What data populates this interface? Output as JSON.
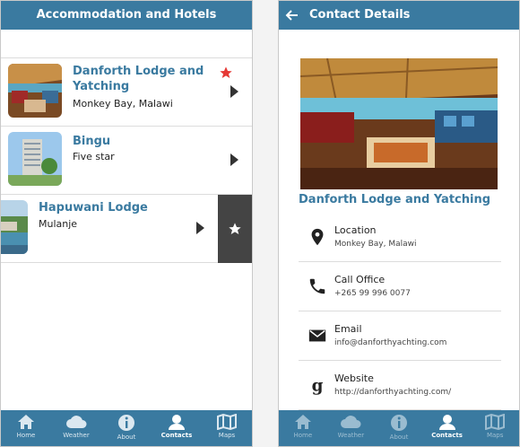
{
  "list_screen": {
    "title": "Accommodation and Hotels",
    "items": [
      {
        "title": "Danforth Lodge and Yatching",
        "subtitle": "Monkey Bay, Malawi",
        "favorite": true
      },
      {
        "title": "Bingu",
        "subtitle": "Five star",
        "favorite": false
      },
      {
        "title": "Hapuwani Lodge",
        "subtitle": "Mulanje",
        "favorite": false
      }
    ]
  },
  "detail_screen": {
    "title": "Contact Details",
    "hotel_name": "Danforth Lodge and Yatching",
    "contacts": [
      {
        "label": "Location",
        "value": "Monkey Bay, Malawi",
        "icon": "location-pin-icon"
      },
      {
        "label": "Call Office",
        "value": "+265 99 996 0077",
        "icon": "phone-icon"
      },
      {
        "label": "Email",
        "value": "info@danforthyachting.com",
        "icon": "email-icon"
      },
      {
        "label": "Website",
        "value": "http://danforthyachting.com/",
        "icon": "google-icon"
      }
    ]
  },
  "tabs": [
    {
      "label": "Home",
      "icon": "home-icon"
    },
    {
      "label": "Weather",
      "icon": "cloud-icon"
    },
    {
      "label": "About",
      "icon": "info-icon"
    },
    {
      "label": "Contacts",
      "icon": "person-icon",
      "active": true
    },
    {
      "label": "Maps",
      "icon": "map-icon"
    }
  ],
  "colors": {
    "header": "#3a7aa0",
    "accent_title": "#3a7aa0",
    "favorite_star": "#e53935",
    "swipe_action": "#444444"
  }
}
